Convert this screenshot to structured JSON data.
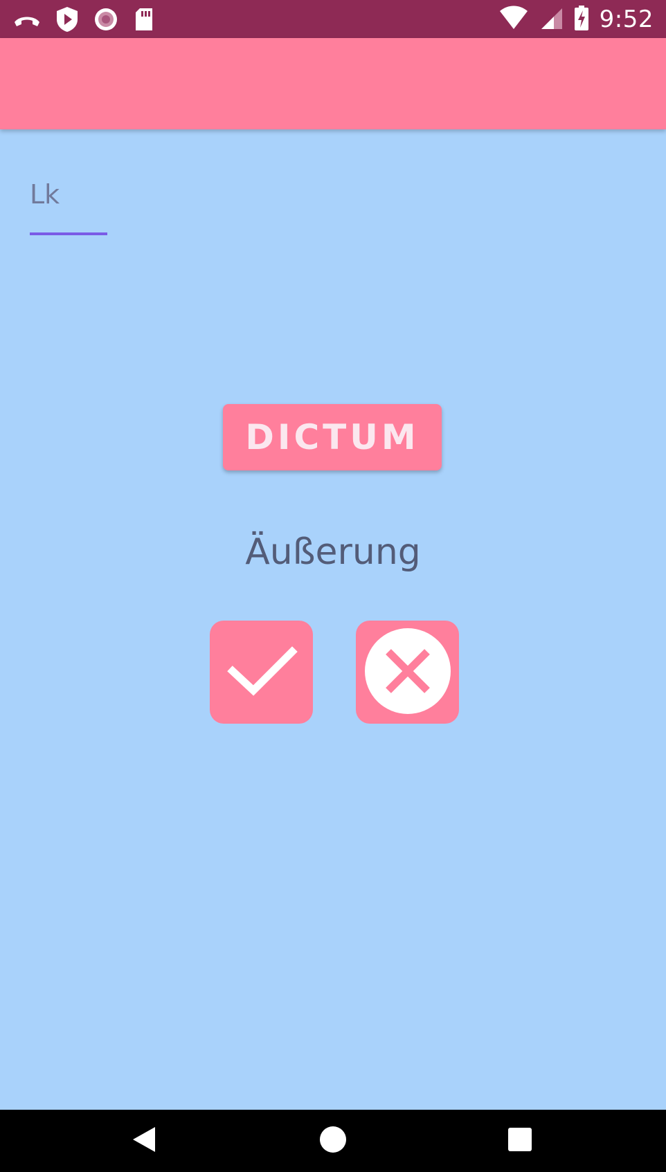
{
  "status_bar": {
    "time": "9:52",
    "left_icons": [
      "phone-hangup-icon",
      "shield-play-icon",
      "record-icon",
      "sd-card-icon"
    ],
    "right_icons": [
      "wifi-icon",
      "signal-icon",
      "battery-charging-icon"
    ]
  },
  "app_bar": {
    "color": "#ff7f9c"
  },
  "input": {
    "value": "Lk"
  },
  "main": {
    "button_label": "DICTUM",
    "word": "Äußerung",
    "accept_icon": "check-icon",
    "reject_icon": "close-circle-icon"
  },
  "nav_bar": {
    "buttons": [
      "back-icon",
      "home-icon",
      "recents-icon"
    ]
  },
  "colors": {
    "background": "#a9d2fb",
    "accent": "#ff7f9c",
    "status_bar": "#8e2a55",
    "underline": "#7a5be6",
    "text": "#535c78"
  }
}
